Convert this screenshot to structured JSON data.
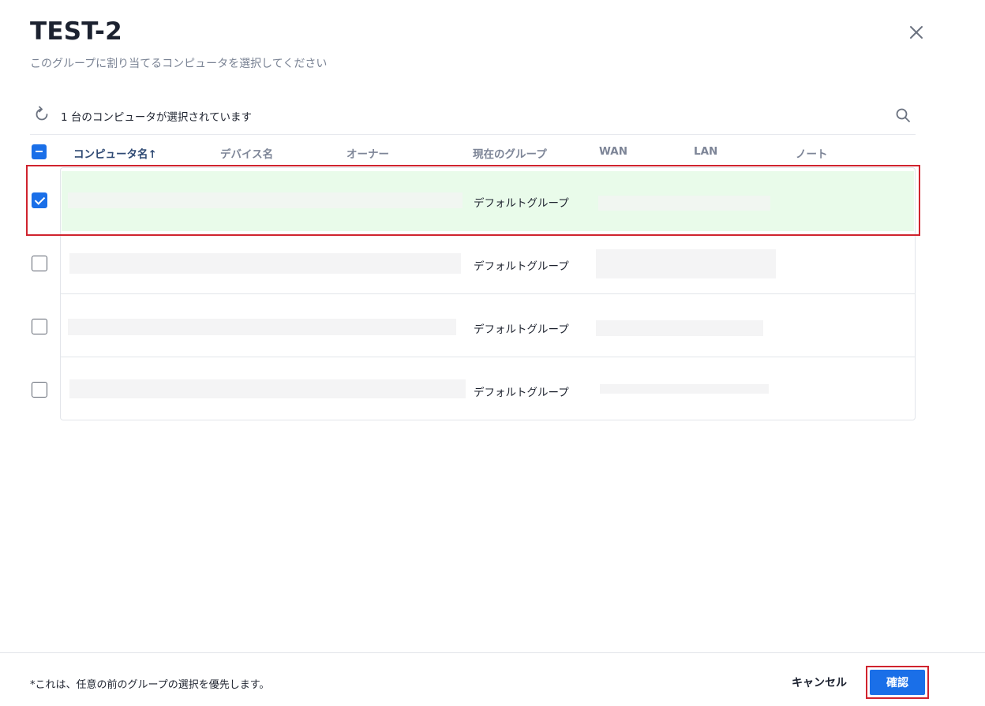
{
  "dialog": {
    "title": "TEST-2",
    "subtitle": "このグループに割り当てるコンピュータを選択してください"
  },
  "toolbar": {
    "status": "1 台のコンピュータが選択されています",
    "refresh_icon": "refresh-icon",
    "search_icon": "search-icon"
  },
  "table": {
    "columns": [
      "コンピュータ名↑",
      "デバイス名",
      "オーナー",
      "現在のグループ",
      "WAN",
      "LAN",
      "ノート"
    ],
    "rows": [
      {
        "selected": true,
        "group": "デフォルトグループ"
      },
      {
        "selected": false,
        "group": "デフォルトグループ"
      },
      {
        "selected": false,
        "group": "デフォルトグループ"
      },
      {
        "selected": false,
        "group": "デフォルトグループ"
      }
    ]
  },
  "footer": {
    "note": "*これは、任意の前のグループの選択を優先します。",
    "cancel_label": "キャンセル",
    "confirm_label": "確認"
  },
  "colors": {
    "accent": "#1a6fe8",
    "selected_row": "#e9fbea",
    "highlight": "#d0232e"
  }
}
